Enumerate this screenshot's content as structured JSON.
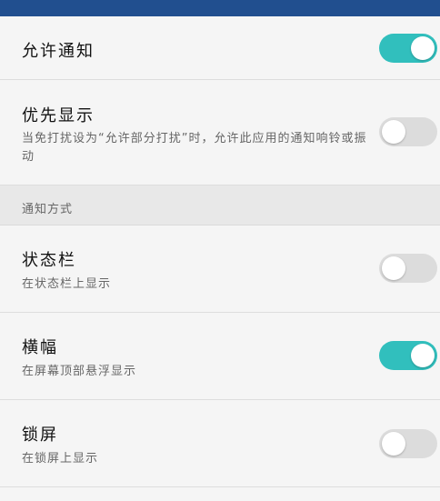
{
  "status_bar": {
    "color": "#214f8f"
  },
  "settings": {
    "allow_notifications": {
      "title": "允许通知",
      "enabled": true
    },
    "priority_display": {
      "title": "优先显示",
      "description": "当免打扰设为“允许部分打扰”时，允许此应用的通知响铃或振动",
      "enabled": false
    },
    "section_header": "通知方式",
    "status_bar_item": {
      "title": "状态栏",
      "description": "在状态栏上显示",
      "enabled": false
    },
    "banner": {
      "title": "横幅",
      "description": "在屏幕顶部悬浮显示",
      "enabled": true
    },
    "lock_screen": {
      "title": "锁屏",
      "description": "在锁屏上显示",
      "enabled": false
    }
  },
  "colors": {
    "toggle_on": "#31bfbd",
    "toggle_off": "#dcdcdc"
  }
}
